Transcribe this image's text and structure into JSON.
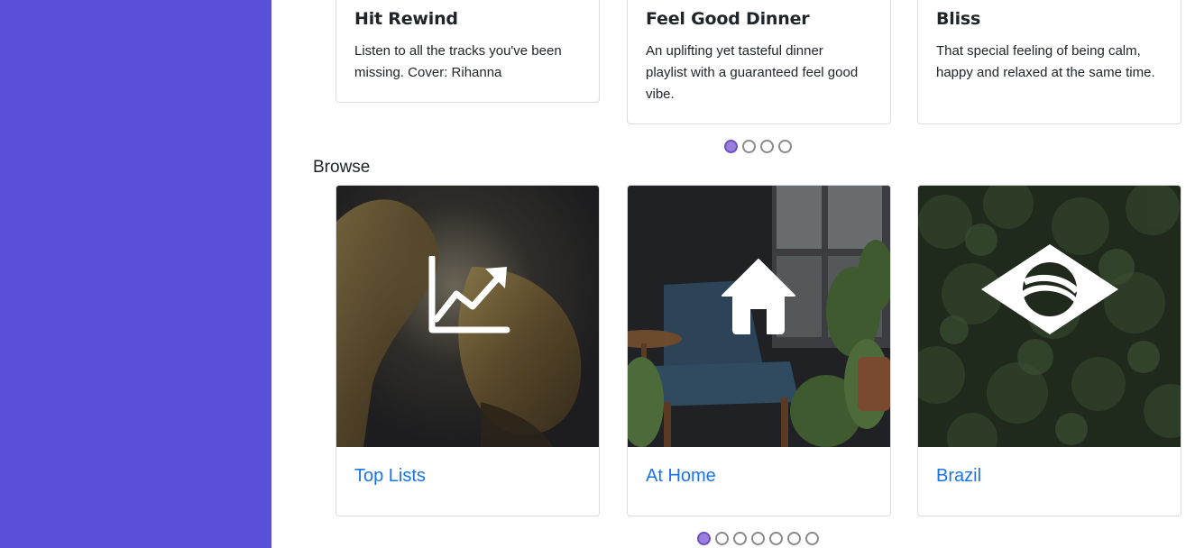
{
  "playlists": [
    {
      "title": "Hit Rewind",
      "description": "Listen to all the tracks you've been missing. Cover: Rihanna"
    },
    {
      "title": "Feel Good Dinner",
      "description": "An uplifting yet tasteful dinner playlist with a guaranteed feel good vibe."
    },
    {
      "title": "Bliss",
      "description": "That special feeling of being calm, happy and relaxed at the same time."
    }
  ],
  "browse": {
    "title": "Browse",
    "categories": [
      {
        "label": "Top Lists",
        "icon": "trending-chart-icon"
      },
      {
        "label": "At Home",
        "icon": "home-icon"
      },
      {
        "label": "Brazil",
        "icon": "brazil-flag-icon"
      }
    ]
  },
  "carousels": {
    "playlists_pages": 4,
    "playlists_active": 1,
    "browse_pages": 7,
    "browse_active": 1
  },
  "colors": {
    "sidebar": "#5a4fd9",
    "link": "#1a73e8",
    "dot_active": "#9b7fde"
  }
}
